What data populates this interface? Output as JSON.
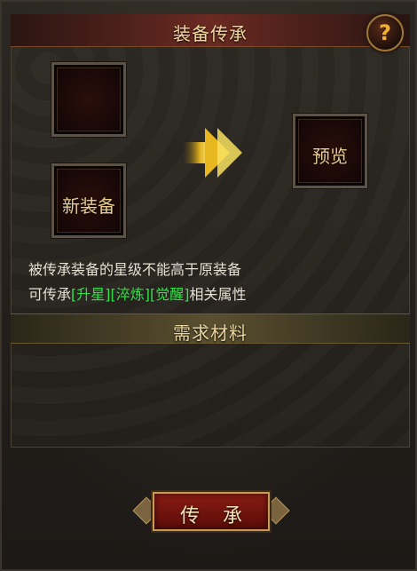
{
  "header": {
    "title": "装备传承",
    "help_symbol": "?"
  },
  "slots": {
    "source_label": "",
    "new_equipment_label": "新装备",
    "preview_label": "预览"
  },
  "description": {
    "line1": "被传承装备的星级不能高于原装备",
    "line2_prefix": "可传承",
    "attr_star": "[升星]",
    "attr_temper": "[淬炼]",
    "attr_awaken": "[觉醒]",
    "line2_suffix": "相关属性"
  },
  "materials": {
    "title": "需求材料"
  },
  "actions": {
    "inherit_button": "传承"
  },
  "colors": {
    "highlight_green": "#33e04a",
    "title_gold": "#f0d9a0",
    "button_red": "#8a1c14"
  }
}
